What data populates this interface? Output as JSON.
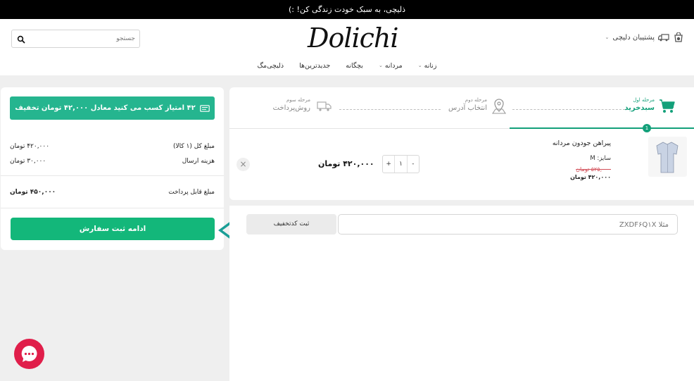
{
  "topbar": {
    "text": "ذلیچی، به سبک خودت زندگی کن! :)"
  },
  "header": {
    "logo": "Dolichi",
    "search_placeholder": "جستجو",
    "support_label": "پشتیبان دلیچی"
  },
  "nav": {
    "items": [
      {
        "label": "زنانه",
        "has_dropdown": true
      },
      {
        "label": "مردانه",
        "has_dropdown": true
      },
      {
        "label": "بچگانه",
        "has_dropdown": false
      },
      {
        "label": "جدیدترین‌ها",
        "has_dropdown": false
      },
      {
        "label": "ذلیچی‌مگ",
        "has_dropdown": false
      }
    ]
  },
  "summary": {
    "points_banner": "۴۲ امتیاز کسب می کنید معادل ۴۲,۰۰۰ تومان تخفیف",
    "total_label": "مبلغ کل (۱ کالا)",
    "total_value": "۴۲۰,۰۰۰ تومان",
    "shipping_label": "هزینه ارسال",
    "shipping_value": "۳۰,۰۰۰ تومان",
    "payable_label": "مبلغ قابل پرداخت",
    "payable_value": "۴۵۰,۰۰۰ تومان",
    "continue_button": "ادامه ثبت سفارش"
  },
  "steps": [
    {
      "small": "مرحله اول",
      "big": "سبدخرید",
      "active": true,
      "icon": "cart-icon"
    },
    {
      "small": "مرحله دوم",
      "big": "انتخاب آدرس",
      "active": false,
      "icon": "map-pin-icon"
    },
    {
      "small": "مرحله سوم",
      "big": "روش‌پرداخت",
      "active": false,
      "icon": "truck-icon"
    }
  ],
  "step_dot": "1",
  "product": {
    "name": "پیراهن جودون مردانه",
    "size": "سایز: M",
    "old_price": "۵۲۵,۰۰۰ تومان",
    "new_price": "۴۲۰,۰۰۰ تومان",
    "quantity": "۱",
    "plus": "+",
    "minus": "-",
    "line_price": "۴۲۰,۰۰۰ تومان",
    "remove": "×",
    "image_icon": "shirt-icon"
  },
  "discount": {
    "placeholder": "مثلا ZXDF۶Q۱X",
    "button": "ثبت کدتخفیف"
  },
  "colors": {
    "accent": "#13b77a",
    "points_bg": "#25b58f",
    "arrow": "#1a9e96",
    "chat": "#e01e4a"
  }
}
